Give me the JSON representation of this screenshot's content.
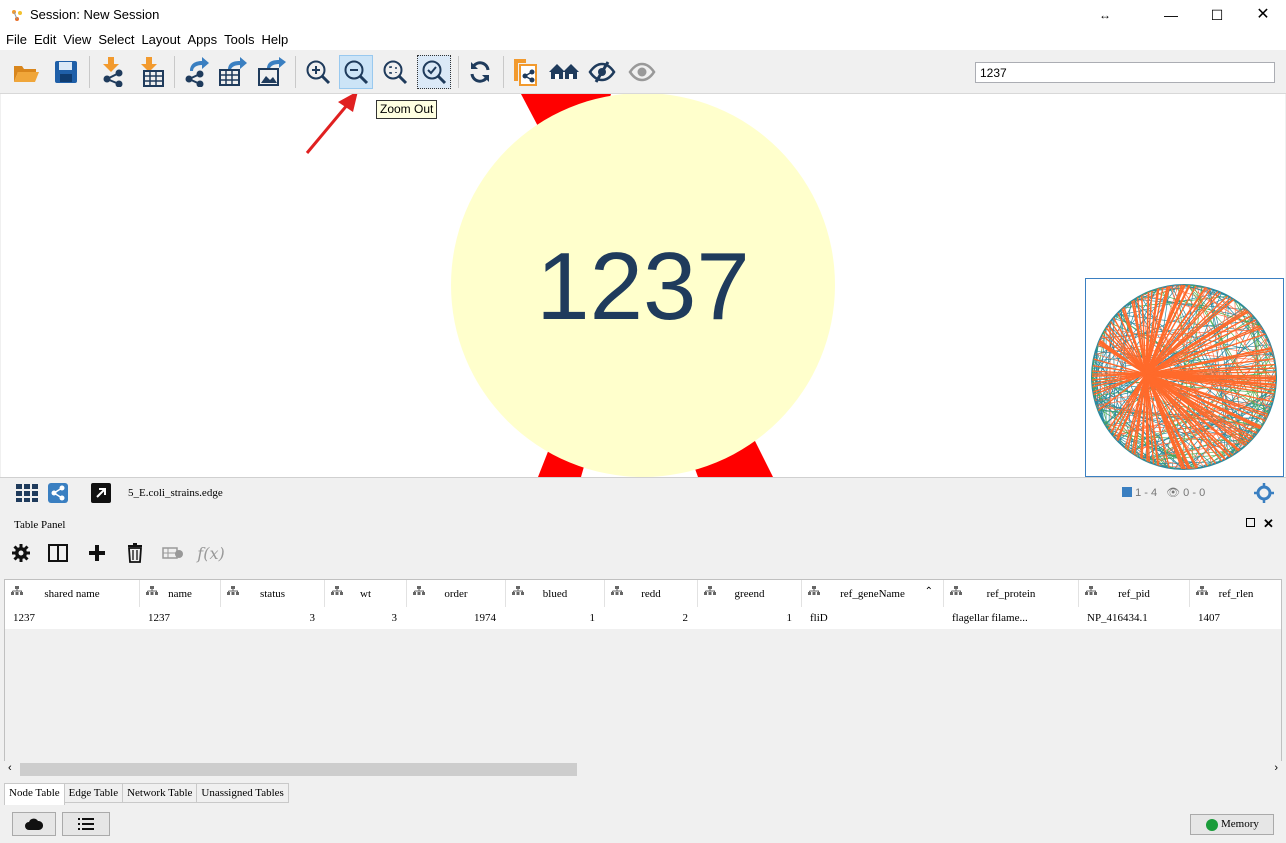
{
  "window": {
    "title": "Session: New Session"
  },
  "menu": [
    "File",
    "Edit",
    "View",
    "Select",
    "Layout",
    "Apps",
    "Tools",
    "Help"
  ],
  "toolbar": {
    "search_value": "1237",
    "tooltip": "Zoom Out",
    "icons": [
      "open-session-icon",
      "save-session-icon",
      "import-network-icon",
      "import-table-icon",
      "export-network-icon",
      "export-table-icon",
      "export-image-icon",
      "zoom-in-icon",
      "zoom-out-icon",
      "zoom-fit-icon",
      "zoom-selected-icon",
      "apply-layout-icon",
      "new-network-from-selection-icon",
      "first-neighbors-icon",
      "hide-selected-icon",
      "show-all-icon"
    ]
  },
  "canvas": {
    "node_label": "1237",
    "node_color": "#ffffcc",
    "edge_color": "#ff0000",
    "label_color": "#1f3b5c",
    "annotation_arrow_color": "#e02020"
  },
  "network_bar": {
    "network_name": "5_E.coli_strains.edge",
    "selected_counts": "1 - 4",
    "hidden_counts": "0 - 0"
  },
  "table_panel": {
    "title": "Table Panel",
    "columns": [
      "shared name",
      "name",
      "status",
      "wt",
      "order",
      "blued",
      "redd",
      "greend",
      "ref_geneName",
      "ref_protein",
      "ref_pid",
      "ref_rlen"
    ],
    "rows": [
      [
        "1237",
        "1237",
        "3",
        "3",
        "1974",
        "1",
        "2",
        "1",
        "fliD",
        "flagellar filame...",
        "NP_416434.1",
        "1407"
      ]
    ],
    "sorted_column": "ref_geneName",
    "tabs": [
      "Node Table",
      "Edge Table",
      "Network Table",
      "Unassigned Tables"
    ],
    "active_tab": "Node Table"
  },
  "status_bar": {
    "memory_label": "Memory",
    "memory_status_color": "#1a9c3a"
  }
}
